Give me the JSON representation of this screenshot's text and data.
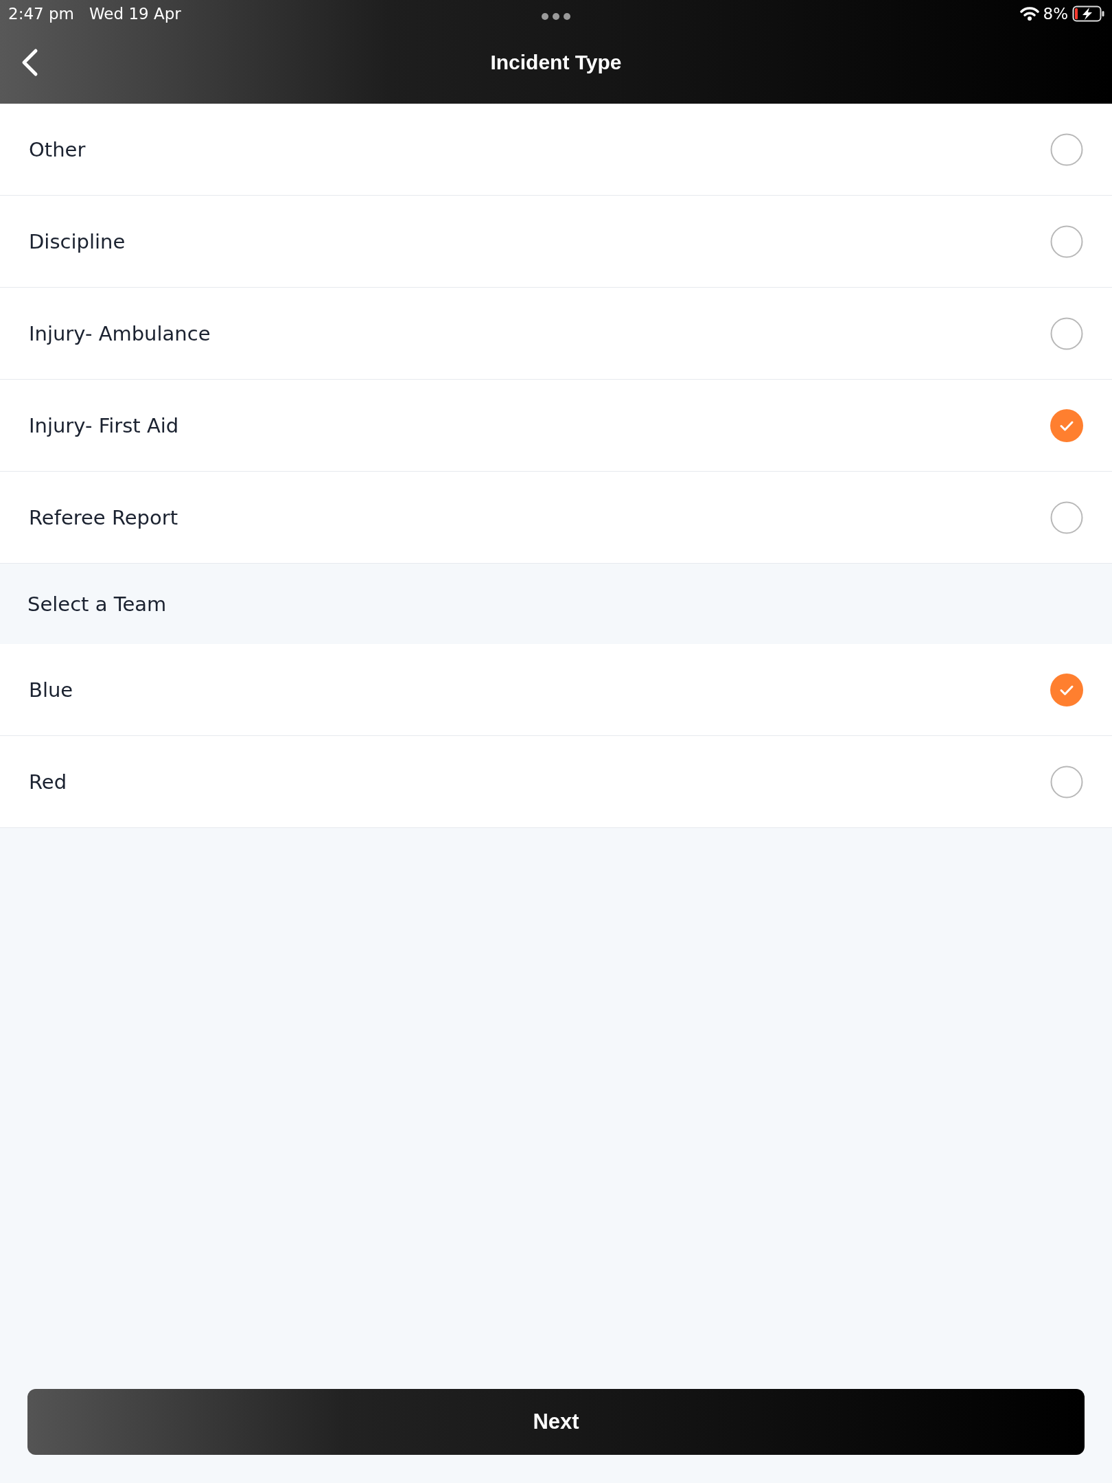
{
  "status_bar": {
    "time": "2:47 pm",
    "date": "Wed 19 Apr",
    "battery": "8%"
  },
  "header": {
    "title": "Incident Type"
  },
  "incident_types": [
    {
      "label": "Other",
      "selected": false
    },
    {
      "label": "Discipline",
      "selected": false
    },
    {
      "label": "Injury- Ambulance",
      "selected": false
    },
    {
      "label": "Injury- First Aid",
      "selected": true
    },
    {
      "label": "Referee Report",
      "selected": false
    }
  ],
  "team_section": {
    "title": "Select a Team"
  },
  "teams": [
    {
      "label": "Blue",
      "selected": true
    },
    {
      "label": "Red",
      "selected": false
    }
  ],
  "next_button": {
    "label": "Next"
  }
}
